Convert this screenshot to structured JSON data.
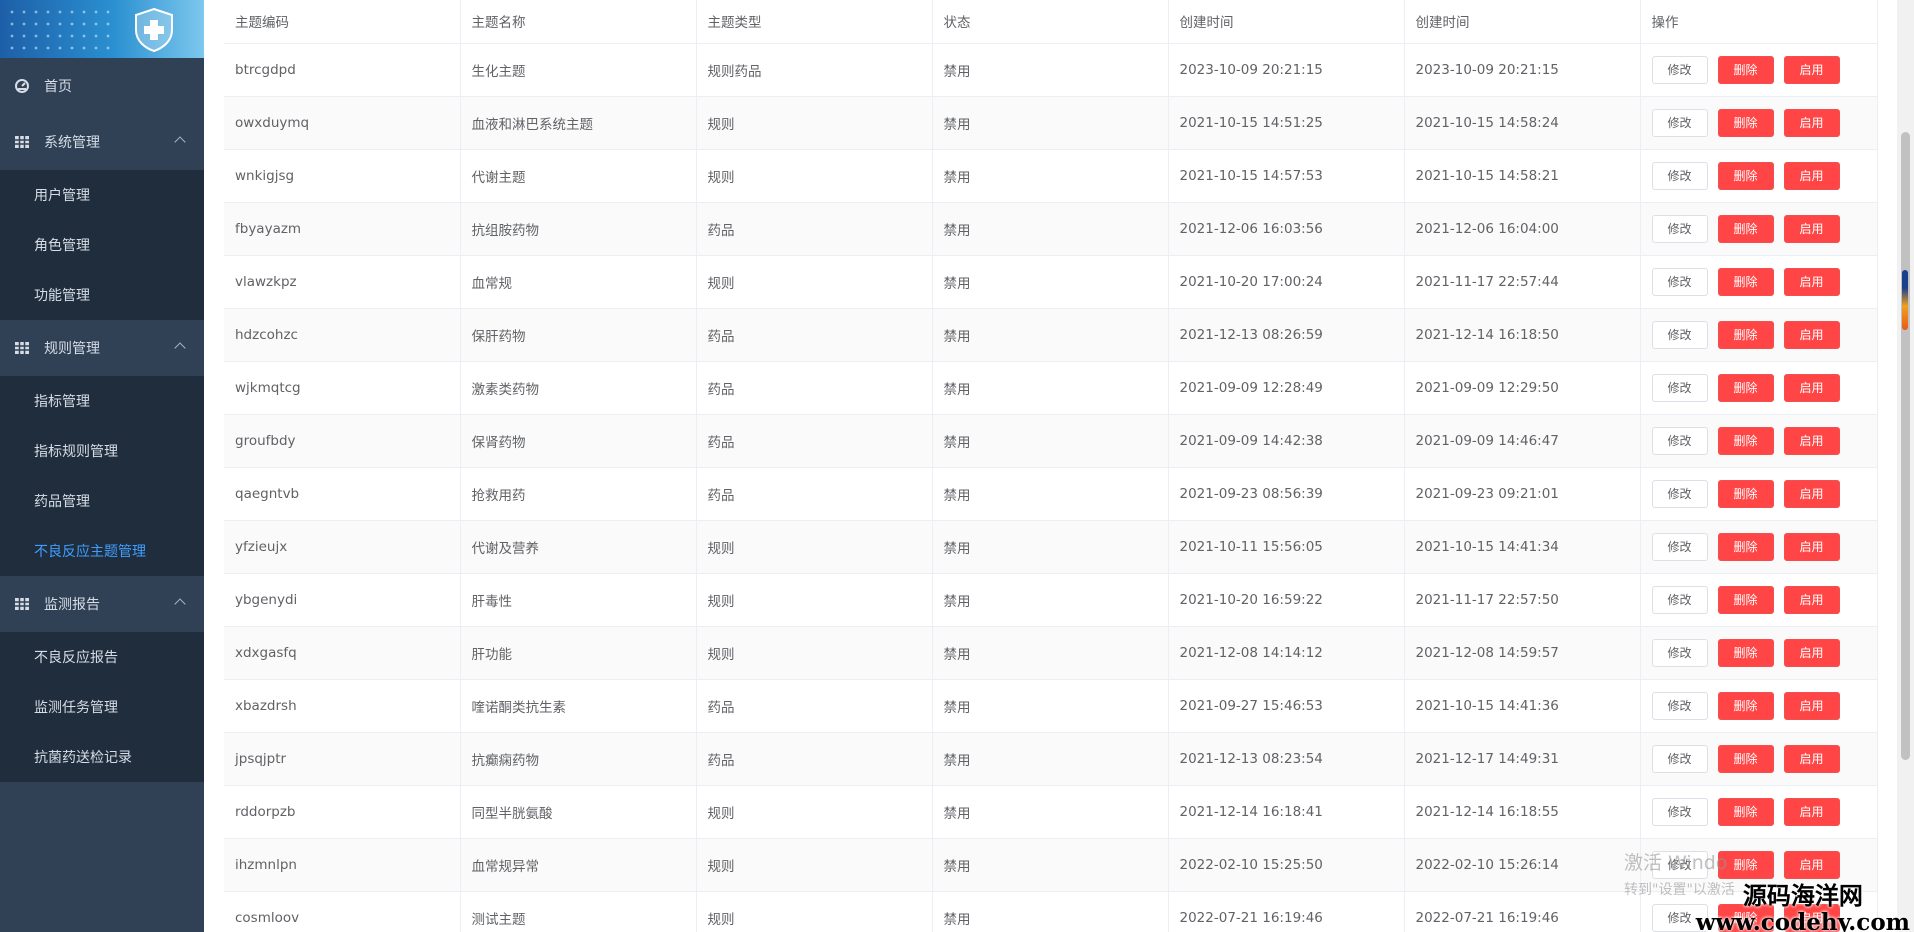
{
  "sidebar": {
    "items": [
      {
        "label": "首页",
        "icon": "dashboard-icon"
      },
      {
        "label": "系统管理",
        "icon": "grid-icon",
        "children": [
          "用户管理",
          "角色管理",
          "功能管理"
        ]
      },
      {
        "label": "规则管理",
        "icon": "grid-icon",
        "children": [
          "指标管理",
          "指标规则管理",
          "药品管理",
          "不良反应主题管理"
        ]
      },
      {
        "label": "监测报告",
        "icon": "grid-icon",
        "children": [
          "不良反应报告",
          "监测任务管理",
          "抗菌药送检记录"
        ]
      }
    ],
    "active_item": "不良反应主题管理"
  },
  "table": {
    "headers": [
      "主题编码",
      "主题名称",
      "主题类型",
      "状态",
      "创建时间",
      "创建时间",
      "操作"
    ],
    "action_labels": {
      "edit": "修改",
      "delete": "删除",
      "enable": "启用"
    },
    "rows": [
      [
        "btrcgdpd",
        "生化主题",
        "规则药品",
        "禁用",
        "2023-10-09 20:21:15",
        "2023-10-09 20:21:15"
      ],
      [
        "owxduymq",
        "血液和淋巴系统主题",
        "规则",
        "禁用",
        "2021-10-15 14:51:25",
        "2021-10-15 14:58:24"
      ],
      [
        "wnkigjsg",
        "代谢主题",
        "规则",
        "禁用",
        "2021-10-15 14:57:53",
        "2021-10-15 14:58:21"
      ],
      [
        "fbyayazm",
        "抗组胺药物",
        "药品",
        "禁用",
        "2021-12-06 16:03:56",
        "2021-12-06 16:04:00"
      ],
      [
        "vlawzkpz",
        "血常规",
        "规则",
        "禁用",
        "2021-10-20 17:00:24",
        "2021-11-17 22:57:44"
      ],
      [
        "hdzcohzc",
        "保肝药物",
        "药品",
        "禁用",
        "2021-12-13 08:26:59",
        "2021-12-14 16:18:50"
      ],
      [
        "wjkmqtcg",
        "激素类药物",
        "药品",
        "禁用",
        "2021-09-09 12:28:49",
        "2021-09-09 12:29:50"
      ],
      [
        "groufbdy",
        "保肾药物",
        "药品",
        "禁用",
        "2021-09-09 14:42:38",
        "2021-09-09 14:46:47"
      ],
      [
        "qaegntvb",
        "抢救用药",
        "药品",
        "禁用",
        "2021-09-23 08:56:39",
        "2021-09-23 09:21:01"
      ],
      [
        "yfzieujx",
        "代谢及营养",
        "规则",
        "禁用",
        "2021-10-11 15:56:05",
        "2021-10-15 14:41:34"
      ],
      [
        "ybgenydi",
        "肝毒性",
        "规则",
        "禁用",
        "2021-10-20 16:59:22",
        "2021-11-17 22:57:50"
      ],
      [
        "xdxgasfq",
        "肝功能",
        "规则",
        "禁用",
        "2021-12-08 14:14:12",
        "2021-12-08 14:59:57"
      ],
      [
        "xbazdrsh",
        "喹诺酮类抗生素",
        "药品",
        "禁用",
        "2021-09-27 15:46:53",
        "2021-10-15 14:41:36"
      ],
      [
        "jpsqjptr",
        "抗癫痫药物",
        "药品",
        "禁用",
        "2021-12-13 08:23:54",
        "2021-12-17 14:49:31"
      ],
      [
        "rddorpzb",
        "同型半胱氨酸",
        "规则",
        "禁用",
        "2021-12-14 16:18:41",
        "2021-12-14 16:18:55"
      ],
      [
        "ihzmnlpn",
        "血常规异常",
        "规则",
        "禁用",
        "2022-02-10 15:25:50",
        "2022-02-10 15:26:14"
      ],
      [
        "cosmloov",
        "测试主题",
        "规则",
        "禁用",
        "2022-07-21 16:19:46",
        "2022-07-21 16:19:46"
      ]
    ]
  },
  "watermark": {
    "activate_line1": "激活 Windo",
    "activate_line2": "转到\"设置\"以激活",
    "brand_line1": "源码海洋网",
    "brand_line2": "www.codehy.com"
  },
  "colors": {
    "sidebar_bg": "#304156",
    "submenu_bg": "#1f2d3d",
    "active": "#409eff",
    "danger": "#ff4545"
  }
}
